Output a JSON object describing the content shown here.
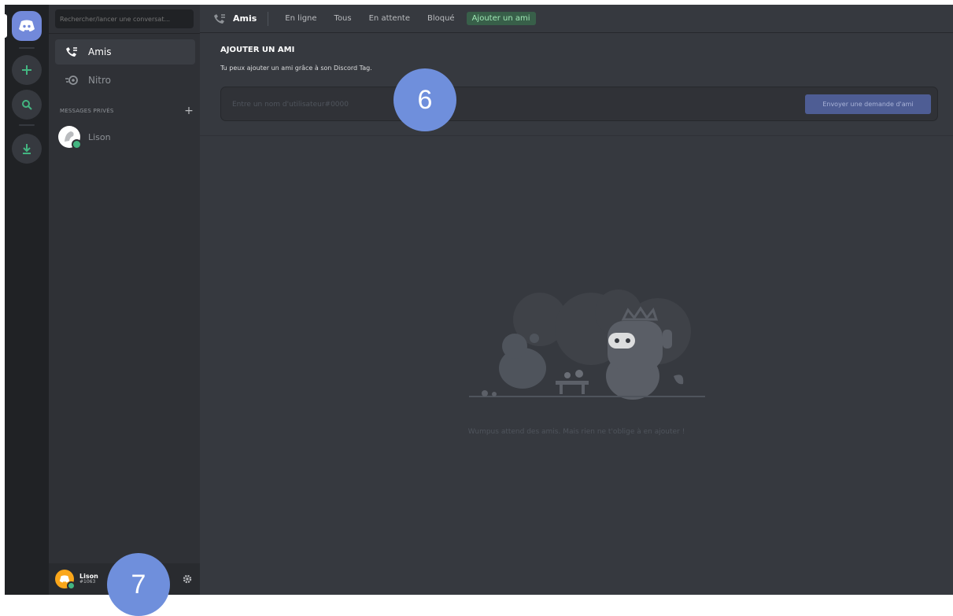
{
  "search": {
    "placeholder": "Rechercher/lancer une conversat..."
  },
  "sidebar": {
    "friends_label": "Amis",
    "nitro_label": "Nitro",
    "dm_header": "MESSAGES PRIVÉS",
    "dm_add": "+",
    "dms": [
      {
        "name": "Lison",
        "status": "online"
      }
    ]
  },
  "user": {
    "name": "Lison",
    "tag": "#1063"
  },
  "topbar": {
    "title": "Amis",
    "tabs": [
      "En ligne",
      "Tous",
      "En attente",
      "Bloqué"
    ],
    "add_friend": "Ajouter un ami"
  },
  "add_friend": {
    "title": "AJOUTER UN AMI",
    "subtitle": "Tu peux ajouter un ami grâce à son Discord Tag.",
    "input_placeholder": "Entre un nom d'utilisateur#0000",
    "send_button": "Envoyer une demande d'ami"
  },
  "empty_state": "Wumpus attend des amis. Mais rien ne t'oblige à en ajouter !",
  "steps": [
    "6",
    "7"
  ],
  "colors": {
    "accent": "#7289da",
    "online": "#43b581",
    "add_friend_tab": "#3ba55c",
    "step_bubble": "#6f8fdc"
  },
  "icons": {
    "home": "discord-logo-icon",
    "add_server": "plus-icon",
    "explore": "search-icon",
    "download": "download-icon",
    "friends": "friends-wave-icon",
    "nitro": "nitro-icon",
    "settings": "gear-icon"
  }
}
